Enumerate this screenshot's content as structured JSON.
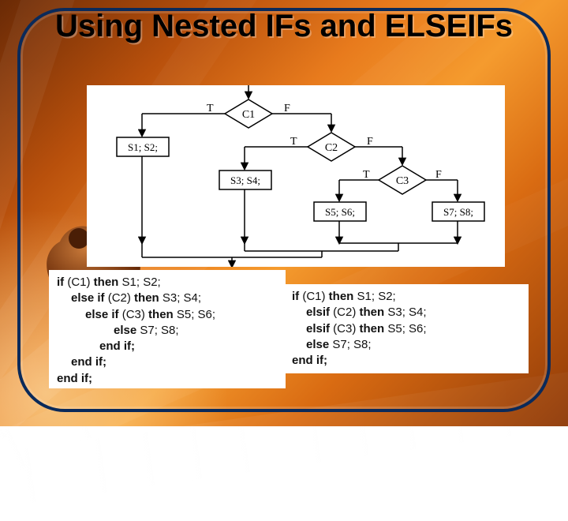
{
  "title": "Using Nested IFs and ELSEIFs",
  "chart_data": {
    "type": "flowchart-decision-cascade",
    "decisions": [
      {
        "id": "C1",
        "label": "C1",
        "true_action": "S1; S2;",
        "false_next": "C2"
      },
      {
        "id": "C2",
        "label": "C2",
        "true_action": "S3; S4;",
        "false_next": "C3"
      },
      {
        "id": "C3",
        "label": "C3",
        "true_action": "S5; S6;",
        "false_action": "S7; S8;"
      }
    ],
    "edge_labels": {
      "true": "T",
      "false": "F"
    },
    "merge": "single bottom merge line"
  },
  "flow": {
    "c1": "C1",
    "c2": "C2",
    "c3": "C3",
    "s12": "S1; S2;",
    "s34": "S3; S4;",
    "s56": "S5; S6;",
    "s78": "S7; S8;",
    "T": "T",
    "F": "F"
  },
  "code_left": {
    "l1a": "if",
    "l1b": " (C1) ",
    "l1c": "then",
    "l1d": " S1; S2;",
    "l2a": "else if",
    "l2b": " (C2) ",
    "l2c": "then",
    "l2d": " S3; S4;",
    "l3a": "else if",
    "l3b": " (C3) ",
    "l3c": "then",
    "l3d": " S5; S6;",
    "l4a": "else",
    "l4b": " S7; S8;",
    "l5": "end if;",
    "l6": "end if;",
    "l7": "end if;"
  },
  "code_right": {
    "l1a": "if",
    "l1b": " (C1) ",
    "l1c": "then",
    "l1d": " S1; S2;",
    "l2a": "elsif",
    "l2b": " (C2) ",
    "l2c": "then",
    "l2d": " S3; S4;",
    "l3a": "elsif",
    "l3b": " (C3) ",
    "l3c": "then",
    "l3d": " S5; S6;",
    "l4a": "else",
    "l4b": " S7; S8;",
    "l5": "end if;"
  }
}
